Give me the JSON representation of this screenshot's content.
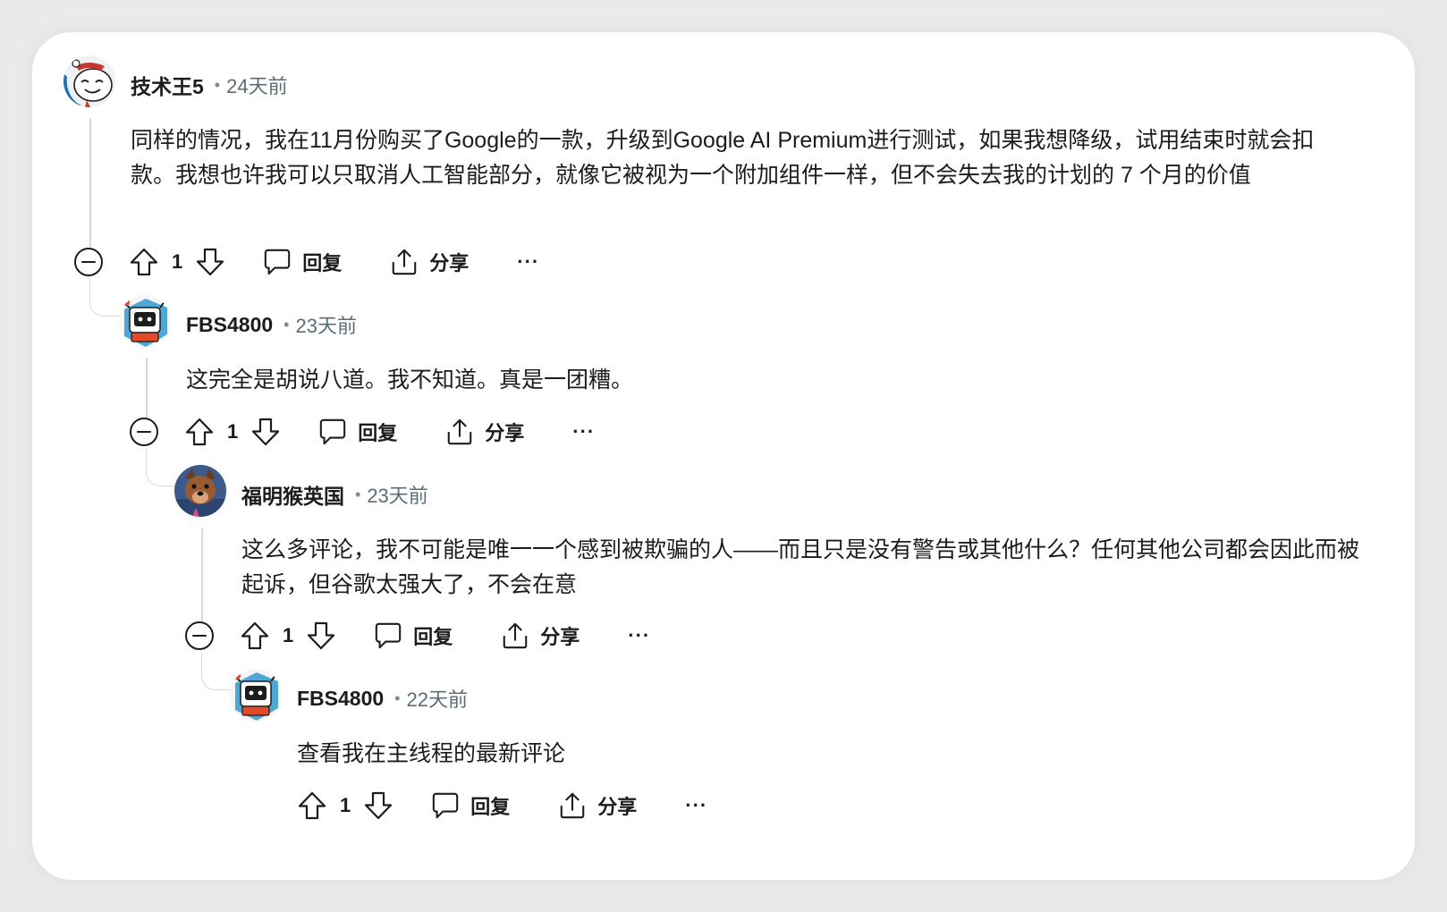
{
  "comments": [
    {
      "username": "技术王5",
      "time": "24天前",
      "body": "同样的情况，我在11月份购买了Google的一款，升级到Google AI Premium进行测试，如果我想降级，试用结束时就会扣款。我想也许我可以只取消人工智能部分，就像它被视为一个附加组件一样，但不会失去我的计划的 7 个月的价值",
      "votes": "1",
      "reply_label": "回复",
      "share_label": "分享",
      "more_label": "···",
      "avatar_icon": "snoo-avatar-icon"
    },
    {
      "username": "FBS4800",
      "time": "23天前",
      "body": "这完全是胡说八道。我不知道。真是一团糟。",
      "votes": "1",
      "reply_label": "回复",
      "share_label": "分享",
      "more_label": "···",
      "avatar_icon": "robot-avatar-icon"
    },
    {
      "username": "福明猴英国",
      "time": "23天前",
      "body": "这么多评论，我不可能是唯一一个感到被欺骗的人——而且只是没有警告或其他什么？任何其他公司都会因此而被起诉，但谷歌太强大了，不会在意",
      "votes": "1",
      "reply_label": "回复",
      "share_label": "分享",
      "more_label": "···",
      "avatar_icon": "dog-avatar-icon"
    },
    {
      "username": "FBS4800",
      "time": "22天前",
      "body": "查看我在主线程的最新评论",
      "votes": "1",
      "reply_label": "回复",
      "share_label": "分享",
      "more_label": "···",
      "avatar_icon": "robot-avatar-icon"
    }
  ],
  "colors": {
    "thread_line": "#d5d9dd",
    "meta_text": "#5c6c74",
    "text": "#1c1c1c"
  }
}
